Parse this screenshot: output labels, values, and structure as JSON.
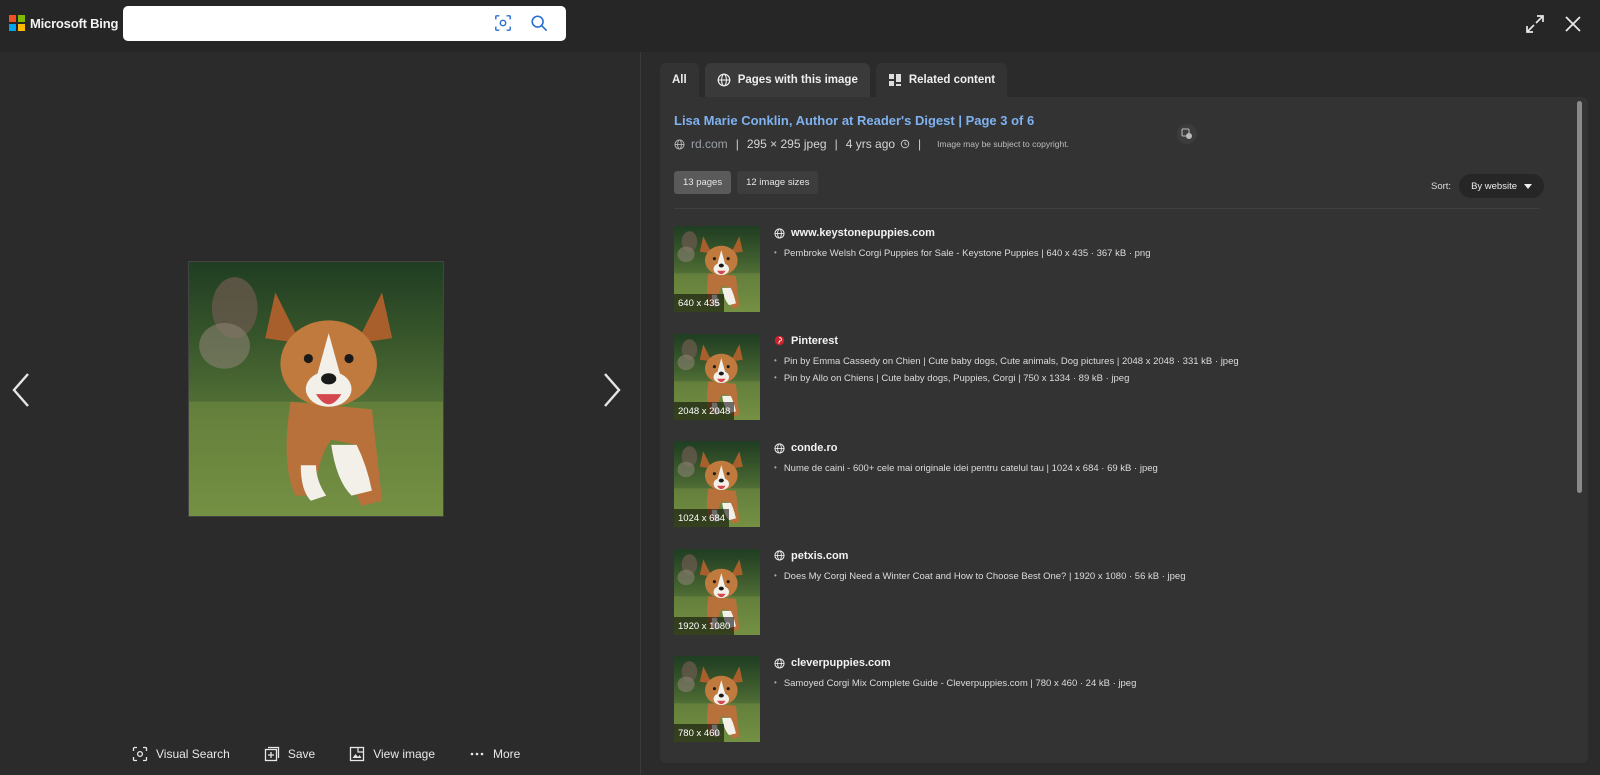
{
  "brand": {
    "name": "Microsoft Bing",
    "logo_colors": [
      "#f25022",
      "#7fba00",
      "#00a4ef",
      "#ffb900"
    ]
  },
  "search": {
    "value": "",
    "placeholder": ""
  },
  "left_actions": [
    {
      "label": "Visual Search",
      "icon": "visual-search-icon"
    },
    {
      "label": "Save",
      "icon": "save-icon"
    },
    {
      "label": "View image",
      "icon": "view-image-icon"
    },
    {
      "label": "More",
      "icon": "more-icon"
    }
  ],
  "tabs": [
    {
      "label": "All",
      "icon": ""
    },
    {
      "label": "Pages with this image",
      "icon": "globe-icon"
    },
    {
      "label": "Related content",
      "icon": "grid-icon"
    }
  ],
  "panel": {
    "title": "Lisa Marie Conklin, Author at Reader's Digest | Page 3 of 6",
    "site": "rd.com",
    "size": "295 × 295 jpeg",
    "age": "4 yrs ago",
    "copyright": "Image may be subject to copyright.",
    "filters": [
      "13 pages",
      "12 image sizes"
    ],
    "sort_label": "Sort:",
    "sort_value": "By website"
  },
  "results": [
    {
      "site": "www.keystonepuppies.com",
      "dims": "640 x 435",
      "icon": "globe-icon",
      "lines": [
        "Pembroke Welsh Corgi Puppies for Sale - Keystone Puppies | 640 x 435 · 367 kB · png"
      ]
    },
    {
      "site": "Pinterest",
      "dims": "2048 x 2048",
      "icon": "pinterest-icon",
      "lines": [
        "Pin by Emma Cassedy on Chien | Cute baby dogs, Cute animals, Dog pictures | 2048 x 2048 · 331 kB · jpeg",
        "Pin by Allo on Chiens | Cute baby dogs, Puppies, Corgi | 750 x 1334 · 89 kB · jpeg"
      ]
    },
    {
      "site": "conde.ro",
      "dims": "1024 x 684",
      "icon": "globe-icon",
      "lines": [
        "Nume de caini - 600+ cele mai originale idei pentru catelul tau | 1024 x 684 · 69 kB · jpeg"
      ]
    },
    {
      "site": "petxis.com",
      "dims": "1920 x 1080",
      "icon": "globe-icon",
      "lines": [
        "Does My Corgi Need a Winter Coat and How to Choose Best One? | 1920 x 1080 · 56 kB · jpeg"
      ]
    },
    {
      "site": "cleverpuppies.com",
      "dims": "780 x 460",
      "icon": "globe-icon",
      "lines": [
        "Samoyed Corgi Mix Complete Guide - Cleverpuppies.com | 780 x 460 · 24 kB · jpeg"
      ]
    }
  ]
}
